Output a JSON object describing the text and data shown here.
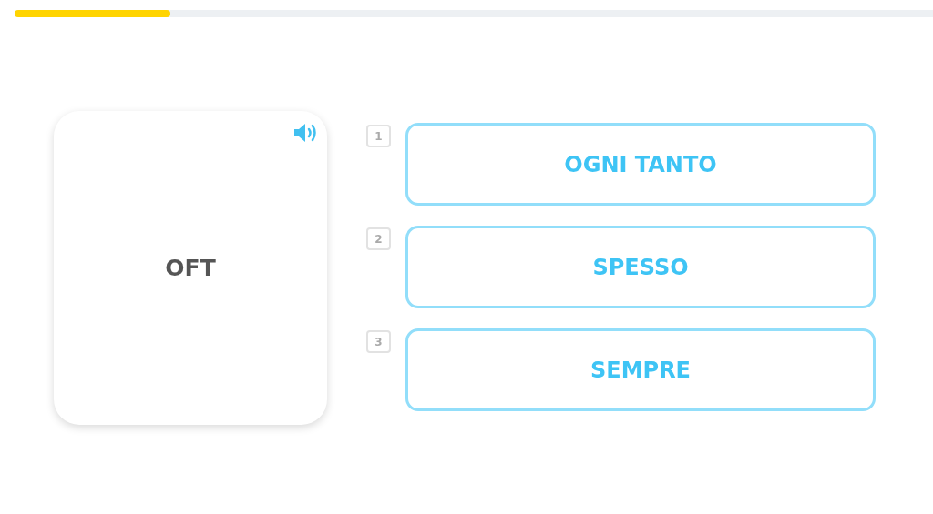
{
  "progress": {
    "level": 0.17
  },
  "prompt_card": {
    "word": "OFT"
  },
  "options": [
    {
      "number": "1",
      "label": "OGNI TANTO"
    },
    {
      "number": "2",
      "label": "SPESSO"
    },
    {
      "number": "3",
      "label": "SEMPRE"
    }
  ]
}
